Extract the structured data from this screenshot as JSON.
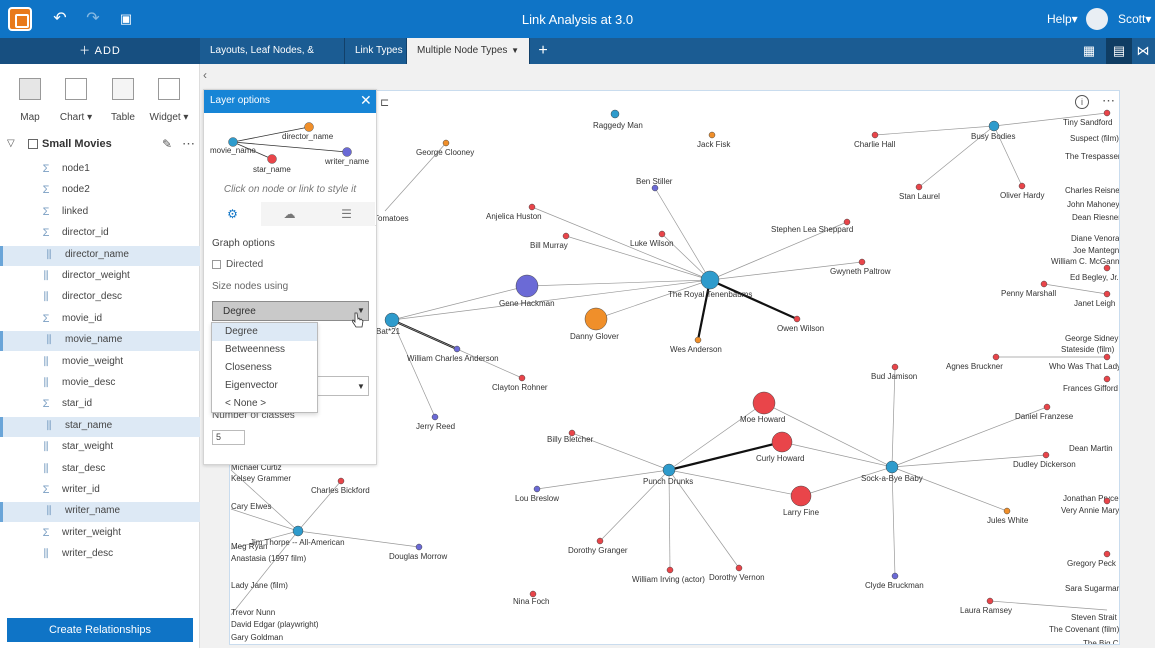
{
  "app": {
    "title": "Link Analysis at 3.0",
    "help_label": "Help▾",
    "user_name": "Scott▾",
    "undo_icon": "undo-icon",
    "redo_icon": "redo-icon",
    "save_icon": "save-icon"
  },
  "toolbar": {
    "add_label": "＋ ADD"
  },
  "tabs": [
    {
      "label": "Layouts, Leaf Nodes, & Symbols",
      "active": false
    },
    {
      "label": "Link Types",
      "active": false
    },
    {
      "label": "Multiple Node Types",
      "active": true
    }
  ],
  "viz_types": [
    {
      "label": "Map"
    },
    {
      "label": "Chart ▾"
    },
    {
      "label": "Table"
    },
    {
      "label": "Widget ▾"
    }
  ],
  "dataset": {
    "name": "Small Movies",
    "fields": [
      {
        "name": "node1",
        "type": "sigma",
        "selected": false
      },
      {
        "name": "node2",
        "type": "sigma",
        "selected": false
      },
      {
        "name": "linked",
        "type": "sigma",
        "selected": false
      },
      {
        "name": "director_id",
        "type": "sigma",
        "selected": false
      },
      {
        "name": "director_name",
        "type": "string",
        "selected": true
      },
      {
        "name": "director_weight",
        "type": "string",
        "selected": false
      },
      {
        "name": "director_desc",
        "type": "string",
        "selected": false
      },
      {
        "name": "movie_id",
        "type": "sigma",
        "selected": false
      },
      {
        "name": "movie_name",
        "type": "string",
        "selected": true
      },
      {
        "name": "movie_weight",
        "type": "string",
        "selected": false
      },
      {
        "name": "movie_desc",
        "type": "string",
        "selected": false
      },
      {
        "name": "star_id",
        "type": "sigma",
        "selected": false
      },
      {
        "name": "star_name",
        "type": "string",
        "selected": true
      },
      {
        "name": "star_weight",
        "type": "string",
        "selected": false
      },
      {
        "name": "star_desc",
        "type": "string",
        "selected": false
      },
      {
        "name": "writer_id",
        "type": "sigma",
        "selected": false
      },
      {
        "name": "writer_name",
        "type": "string",
        "selected": true
      },
      {
        "name": "writer_weight",
        "type": "sigma",
        "selected": false
      },
      {
        "name": "writer_desc",
        "type": "string",
        "selected": false
      }
    ]
  },
  "create_relationships_label": "Create Relationships",
  "layer_options": {
    "title": "Layer options",
    "diagram_labels": {
      "movie": "movie_name",
      "director": "director_name",
      "star": "star_name",
      "writer": "writer_name"
    },
    "hint": "Click on node or link to style it",
    "graph_options_label": "Graph options",
    "directed_label": "Directed",
    "size_nodes_label": "Size nodes using",
    "size_selected": "Degree",
    "size_options": [
      "Degree",
      "Betweenness",
      "Closeness",
      "Eigenvector",
      "< None >"
    ],
    "num_classes_label": "Number of classes",
    "num_classes_value": "5"
  },
  "colors": {
    "movie": "#2e9bcc",
    "director": "#f08f2a",
    "star": "#e9454a",
    "writer": "#6b6ad6",
    "brand_blue": "#0f74c6"
  },
  "graph": {
    "labels": [
      "Raggedy Man",
      "Jack Fisk",
      "George Clooney",
      "Tomatoes",
      "Busy Bodies",
      "Tiny Sandford",
      "Suspect (film)",
      "The Trespasser",
      "Charlie Hall",
      "Stan Laurel",
      "Oliver Hardy",
      "Charles Reisner",
      "John Mahoney",
      "Dean Riesner",
      "Diane Venora",
      "Joe Mantegna",
      "William C. McGann",
      "Ed Begley, Jr.",
      "Janet Leigh",
      "Penny Marshall",
      "Ben Stiller",
      "Anjelica Huston",
      "Bill Murray",
      "Luke Wilson",
      "Stephen Lea Sheppard",
      "Gwyneth Paltrow",
      "The Royal Tenenbaums",
      "Gene Hackman",
      "Danny Glover",
      "Wes Anderson",
      "Owen Wilson",
      "Bat*21",
      "William Charles Anderson",
      "Clayton Rohner",
      "Jerry Reed",
      "George Sidney",
      "Stateside (film)",
      "Agnes Bruckner",
      "Who Was That Lady?",
      "Frances Gifford",
      "Daniel Franzese",
      "Bud Jamison",
      "Moe Howard",
      "Curly Howard",
      "Larry Fine",
      "Punch Drunks",
      "Sock-a-Bye Baby",
      "Billy Bletcher",
      "Lou Breslow",
      "Dorothy Granger",
      "William Irving (actor)",
      "Dorothy Vernon",
      "Clyde Bruckman",
      "Jules White",
      "Dudley Dickerson",
      "Dean Martin",
      "Jonathan Pryce",
      "Very Annie Mary",
      "Gregory Peck",
      "Sara Sugarman",
      "Laura Ramsey",
      "Steven Strait",
      "The Covenant (film)",
      "The Big C",
      "Nina Foch",
      "Michael Curtiz",
      "Kelsey Grammer",
      "Charles Bickford",
      "Cary Elwes",
      "Jim Thorpe -- All-American",
      "Meg Ryan",
      "Anastasia (1997 film)",
      "Douglas Morrow",
      "Lady Jane (film)",
      "Trevor Nunn",
      "David Edgar (playwright)",
      "Gary Goldman"
    ]
  }
}
